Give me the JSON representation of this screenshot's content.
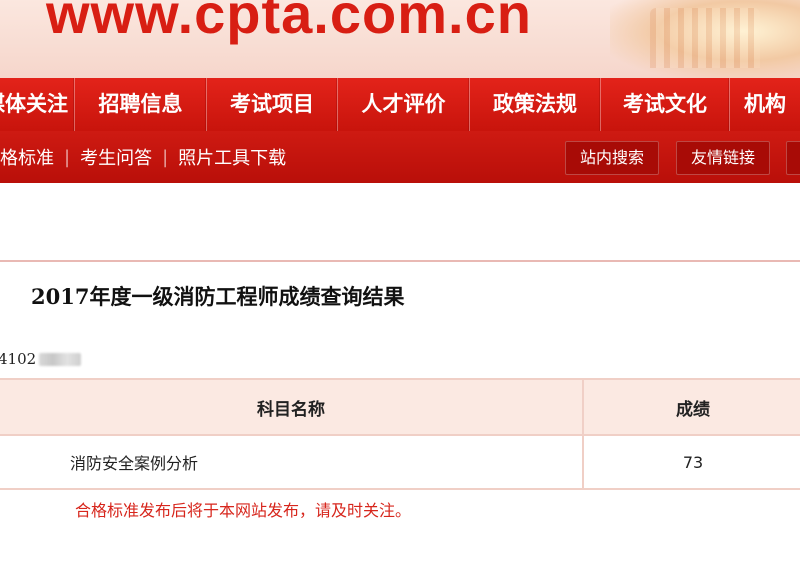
{
  "header": {
    "site_url": "www.cpta.com.cn"
  },
  "nav": {
    "items": [
      {
        "label": "媒体关注",
        "name": "nav-media-focus"
      },
      {
        "label": "招聘信息",
        "name": "nav-recruitment"
      },
      {
        "label": "考试项目",
        "name": "nav-exam-projects"
      },
      {
        "label": "人才评价",
        "name": "nav-talent-evaluation"
      },
      {
        "label": "政策法规",
        "name": "nav-policies"
      },
      {
        "label": "考试文化",
        "name": "nav-exam-culture"
      },
      {
        "label": "机构",
        "name": "nav-institutions"
      }
    ]
  },
  "subnav": {
    "links": [
      "合格标准",
      "考生问答",
      "照片工具下载"
    ],
    "site_search": "站内搜索",
    "friend_links": "友情链接"
  },
  "result": {
    "title": "2017年度一级消防工程师成绩查询结果",
    "id_visible": "4102"
  },
  "table": {
    "headers": [
      "科目名称",
      "成绩"
    ],
    "rows": [
      {
        "subject": "消防安全案例分析",
        "score": "73"
      }
    ]
  },
  "notice": "合格标准发布后将于本网站发布，请及时关注。",
  "colors": {
    "brand_red": "#d81e13",
    "nav_red": "#e3231a",
    "table_header_bg": "#fbe9e2",
    "notice_red": "#d7261c"
  }
}
